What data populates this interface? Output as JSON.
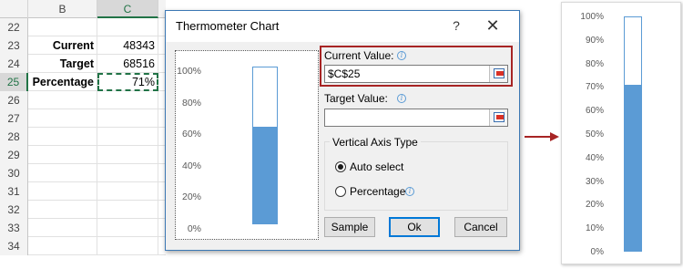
{
  "sheet": {
    "col_b": "B",
    "col_c": "C",
    "rows": [
      {
        "num": "22",
        "b": "",
        "c": ""
      },
      {
        "num": "23",
        "b": "Current",
        "c": "48343"
      },
      {
        "num": "24",
        "b": "Target",
        "c": "68516"
      },
      {
        "num": "25",
        "b": "Percentage",
        "c": "71%"
      },
      {
        "num": "26",
        "b": "",
        "c": ""
      },
      {
        "num": "27",
        "b": "",
        "c": ""
      },
      {
        "num": "28",
        "b": "",
        "c": ""
      },
      {
        "num": "29",
        "b": "",
        "c": ""
      },
      {
        "num": "30",
        "b": "",
        "c": ""
      },
      {
        "num": "31",
        "b": "",
        "c": ""
      },
      {
        "num": "32",
        "b": "",
        "c": ""
      },
      {
        "num": "33",
        "b": "",
        "c": ""
      },
      {
        "num": "34",
        "b": "",
        "c": ""
      }
    ]
  },
  "dialog": {
    "title": "Thermometer Chart",
    "help_glyph": "?",
    "close_glyph": "✕",
    "current_value_label": "Current Value:",
    "current_value": "$C$25",
    "target_value_label": "Target Value:",
    "target_value": "",
    "axis_group_title": "Vertical Axis Type",
    "auto_select_label": "Auto select",
    "percentage_label": "Percentage",
    "info_glyph": "i",
    "sample_label": "Sample",
    "ok_label": "Ok",
    "cancel_label": "Cancel",
    "auto_select_checked": true,
    "percentage_checked": false
  },
  "preview_chart": {
    "axis_labels": [
      "100%",
      "80%",
      "60%",
      "40%",
      "20%",
      "0%"
    ],
    "fill_fraction": 0.62,
    "bar_color": "#5b9bd5"
  },
  "result_chart": {
    "axis_labels": [
      "100%",
      "90%",
      "80%",
      "70%",
      "60%",
      "50%",
      "40%",
      "30%",
      "20%",
      "10%",
      "0%"
    ],
    "fill_fraction": 0.71,
    "bar_color": "#5b9bd5"
  },
  "colors": {
    "arrow": "#a72424",
    "highlight_border": "#a72424",
    "excel_green": "#217346"
  },
  "chart_data": [
    {
      "type": "bar",
      "categories": [
        ""
      ],
      "values": [
        62
      ],
      "ylim": [
        0,
        100
      ],
      "yticks": [
        "0%",
        "20%",
        "40%",
        "60%",
        "80%",
        "100%"
      ]
    },
    {
      "type": "bar",
      "categories": [
        ""
      ],
      "values": [
        71
      ],
      "ylim": [
        0,
        100
      ],
      "yticks": [
        "0%",
        "10%",
        "20%",
        "30%",
        "40%",
        "50%",
        "60%",
        "70%",
        "80%",
        "90%",
        "100%"
      ]
    }
  ]
}
